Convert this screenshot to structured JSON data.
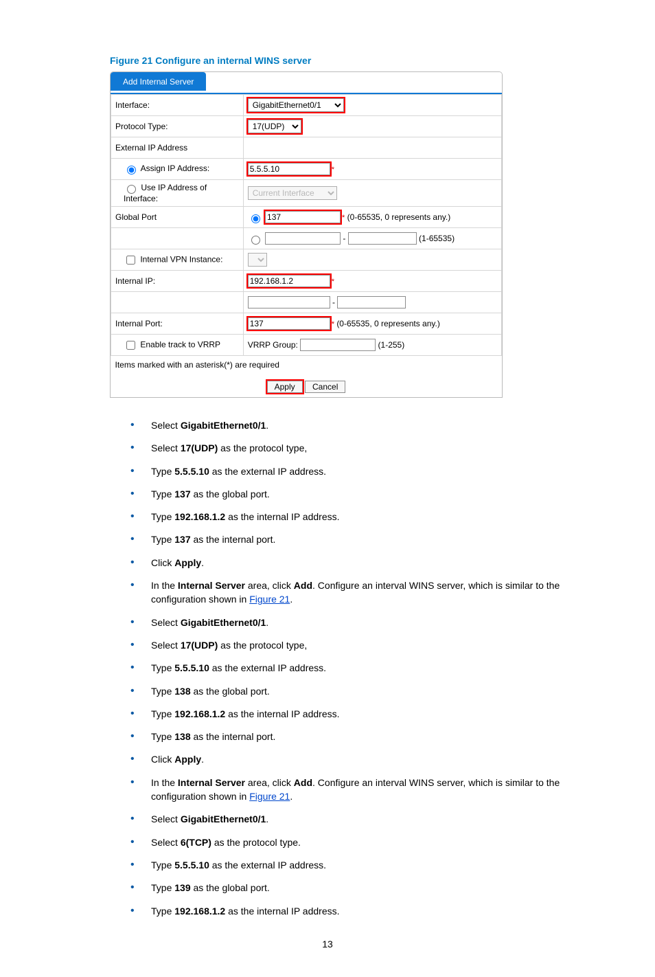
{
  "caption": "Figure 21 Configure an internal WINS server",
  "form": {
    "tab": "Add Internal Server",
    "labels": {
      "interface": "Interface:",
      "protocol": "Protocol Type:",
      "extip": "External IP Address",
      "assign": "Assign IP Address:",
      "useiface": "Use IP Address of Interface:",
      "gport": "Global Port",
      "vpn": "Internal VPN Instance:",
      "iip": "Internal IP:",
      "iport": "Internal Port:",
      "vrrp": "Enable track to VRRP",
      "vrrpgrp": "VRRP Group:",
      "note": "Items marked with an asterisk(*) are required",
      "apply": "Apply",
      "cancel": "Cancel"
    },
    "values": {
      "interface": "GigabitEthernet0/1",
      "protocol": "17(UDP)",
      "assignip": "5.5.5.10",
      "useiface": "Current Interface",
      "gport": "137",
      "gport_hint": "(0-65535, 0 represents any.)",
      "range_hint": "(1-65535)",
      "iip": "192.168.1.2",
      "iport": "137",
      "iport_hint": "(0-65535, 0 represents any.)",
      "vrrp_hint": "(1-255)"
    }
  },
  "steps": [
    {
      "pre": "Select ",
      "b": "GigabitEthernet0/1",
      "post": "."
    },
    {
      "pre": "Select ",
      "b": "17(UDP)",
      "post": " as the protocol type,"
    },
    {
      "pre": "Type ",
      "b": "5.5.5.10",
      "post": " as the external IP address."
    },
    {
      "pre": "Type ",
      "b": "137",
      "post": " as the global port."
    },
    {
      "pre": "Type ",
      "b": "192.168.1.2",
      "post": " as the internal IP address."
    },
    {
      "pre": "Type ",
      "b": "137",
      "post": " as the internal port."
    },
    {
      "pre": "Click ",
      "b": "Apply",
      "post": "."
    },
    {
      "pre": "In the ",
      "b": "Internal Server",
      "post": " area, click ",
      "b2": "Add",
      "post2": ". Configure an interval WINS server, which is similar to the configuration shown in ",
      "link": "Figure 21",
      "post3": "."
    },
    {
      "pre": "Select ",
      "b": "GigabitEthernet0/1",
      "post": "."
    },
    {
      "pre": "Select ",
      "b": "17(UDP)",
      "post": " as the protocol type,"
    },
    {
      "pre": "Type ",
      "b": "5.5.5.10",
      "post": " as the external IP address."
    },
    {
      "pre": "Type ",
      "b": "138",
      "post": " as the global port."
    },
    {
      "pre": "Type ",
      "b": "192.168.1.2",
      "post": " as the internal IP address."
    },
    {
      "pre": "Type ",
      "b": "138",
      "post": " as the internal port."
    },
    {
      "pre": "Click ",
      "b": "Apply",
      "post": "."
    },
    {
      "pre": "In the ",
      "b": "Internal Server",
      "post": " area, click ",
      "b2": "Add",
      "post2": ". Configure an interval WINS server, which is similar to the configuration shown in ",
      "link": "Figure 21",
      "post3": "."
    },
    {
      "pre": "Select ",
      "b": "GigabitEthernet0/1",
      "post": "."
    },
    {
      "pre": "Select ",
      "b": "6(TCP)",
      "post": " as the protocol type."
    },
    {
      "pre": "Type ",
      "b": "5.5.5.10",
      "post": " as the external IP address."
    },
    {
      "pre": "Type ",
      "b": "139",
      "post": " as the global port."
    },
    {
      "pre": "Type ",
      "b": "192.168.1.2",
      "post": " as the internal IP address."
    }
  ],
  "pagenum": "13"
}
